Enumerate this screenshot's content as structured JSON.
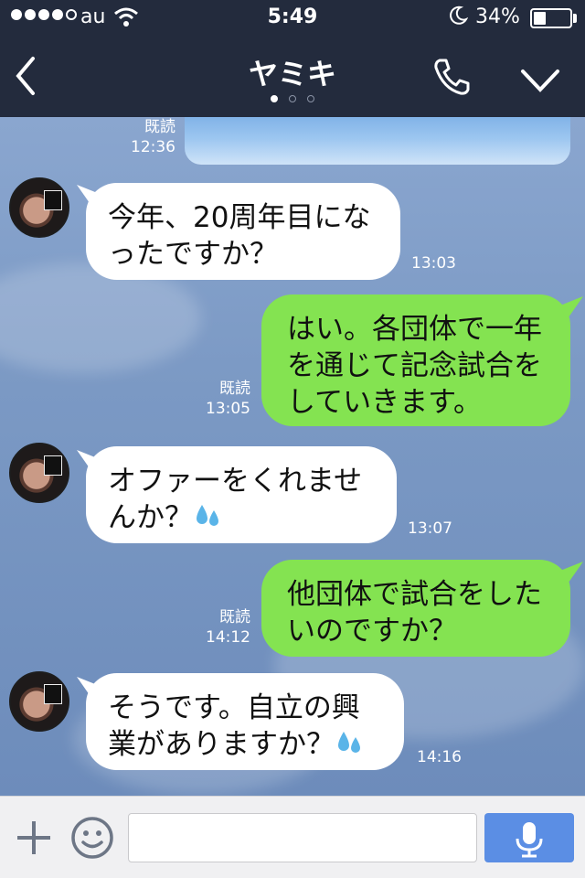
{
  "status_bar": {
    "carrier": "au",
    "time": "5:49",
    "battery_percent": "34%",
    "battery_level": 0.34,
    "signal_bars_filled": 4,
    "signal_bars_total": 5
  },
  "header": {
    "title": "ヤミキ",
    "page_indicator": {
      "count": 3,
      "active": 0
    }
  },
  "messages": [
    {
      "type": "image",
      "direction": "out",
      "read": "既読",
      "time": "12:36"
    },
    {
      "direction": "in",
      "lines": [
        "今年、20周年目にな",
        "ったですか？"
      ],
      "time": "13:03"
    },
    {
      "direction": "out",
      "lines": [
        "はい。各団体で一年",
        "を通じて記念試合を",
        "していきます。"
      ],
      "read": "既読",
      "time": "13:05"
    },
    {
      "direction": "in",
      "lines": [
        "オファーをくれませ",
        "んか？"
      ],
      "time": "13:07",
      "emoji": "sweat-drops"
    },
    {
      "direction": "out",
      "lines": [
        "他団体で試合をした",
        "いのですか？"
      ],
      "read": "既読",
      "time": "14:12"
    },
    {
      "direction": "in",
      "lines": [
        "そうです。自立の興",
        "業がありますか？"
      ],
      "time": "14:16",
      "emoji": "sweat-drops"
    }
  ],
  "avatar_label": "ヤミキ",
  "input": {
    "placeholder": "",
    "value": ""
  },
  "colors": {
    "header": "#232b3d",
    "outgoing_bubble": "#84e351",
    "incoming_bubble": "#ffffff",
    "mic_button": "#5b8ee4"
  },
  "icons": [
    "back-icon",
    "phone-icon",
    "chevron-down-icon",
    "plus-icon",
    "smiley-icon",
    "microphone-icon",
    "wifi-icon",
    "moon-icon",
    "sweat-drops-icon"
  ]
}
